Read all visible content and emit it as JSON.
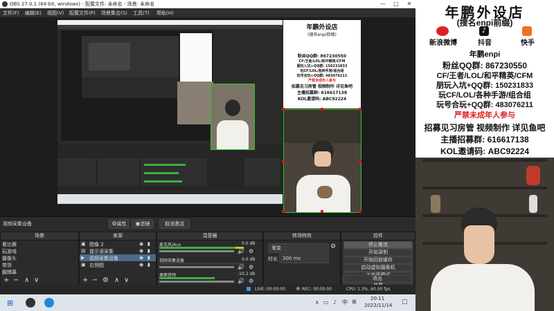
{
  "window": {
    "title": "OBS 27.0.1 (64-bit, windows) - 配置文件: 未命名 - 场景: 未命名",
    "min": "—",
    "max": "□",
    "close": "✕"
  },
  "menu": [
    "文件(F)",
    "编辑(E)",
    "视图(V)",
    "配置文件(P)",
    "场景集合(S)",
    "工具(T)",
    "帮助(H)"
  ],
  "source_bar": {
    "selected_source": "视频采集设备",
    "properties": "属性",
    "filters": "滤镜",
    "deactivate": "取消激活"
  },
  "docks": {
    "scenes": {
      "title": "场景",
      "items": [
        "看比赛",
        "玩游戏",
        "摄像头",
        "带货",
        "翻牌幕"
      ]
    },
    "sources": {
      "title": "来源",
      "items": [
        "图像 2",
        "提示语采集",
        "视频采集设备",
        "右侧图"
      ]
    },
    "mixer": {
      "title": "混音器",
      "channels": [
        {
          "name": "麦克风/Aux",
          "level": "0.0 dB"
        },
        {
          "name": "视频采集设备",
          "level": "0.0 dB"
        },
        {
          "name": "桌面音频",
          "level": "-10.2 dB"
        }
      ],
      "scale": [
        "-60",
        "-55",
        "-50",
        "-45",
        "-40",
        "-35",
        "-30",
        "-25",
        "-20",
        "-15",
        "-10",
        "-5",
        "0"
      ]
    },
    "transitions": {
      "title": "转场特效",
      "type": "渐变",
      "duration_label": "时长",
      "duration_value": "300 ms"
    },
    "controls": {
      "title": "控件",
      "buttons": [
        "停止推流",
        "开始录制",
        "开始回放缓存",
        "启动虚拟摄像机",
        "工作室模式",
        "设置",
        "退出"
      ]
    }
  },
  "status": {
    "live": "LIVE: 00:00:00",
    "rec": "REC: 00:00:00",
    "cpu": "CPU: 1.3%, 60.00 fps"
  },
  "taskbar": {
    "time": "20:11",
    "date": "2022/11/14",
    "ime": "中"
  },
  "poster": {
    "shop_title": "年鹏外设店",
    "shop_sub": "(搜名enpi前缀)",
    "socials": [
      "新浪微博",
      "抖音",
      "快手"
    ],
    "name": "年鹏enpi",
    "fan_group": "粉丝QQ群: 867230550",
    "games": "CF/王者/LOL/和平精英/CFM",
    "group1": "朋玩入坑+QQ群: 150231833",
    "group2_label": "玩CF/LOL/各种手游/组合组",
    "group3": "玩号合玩+QQ群: 483076211",
    "warning": "严禁未成年人参与",
    "recruit": "招募见习房管 视频制作 详见鱼吧",
    "anchor_group": "主播招募群: 616617138",
    "kol": "KOL邀请码: ABC92224"
  },
  "colors": {
    "obs_bg": "#2b2b2b",
    "accent_red": "#e02020",
    "selection_green": "#20d020",
    "meter_green": "#3cb043"
  }
}
